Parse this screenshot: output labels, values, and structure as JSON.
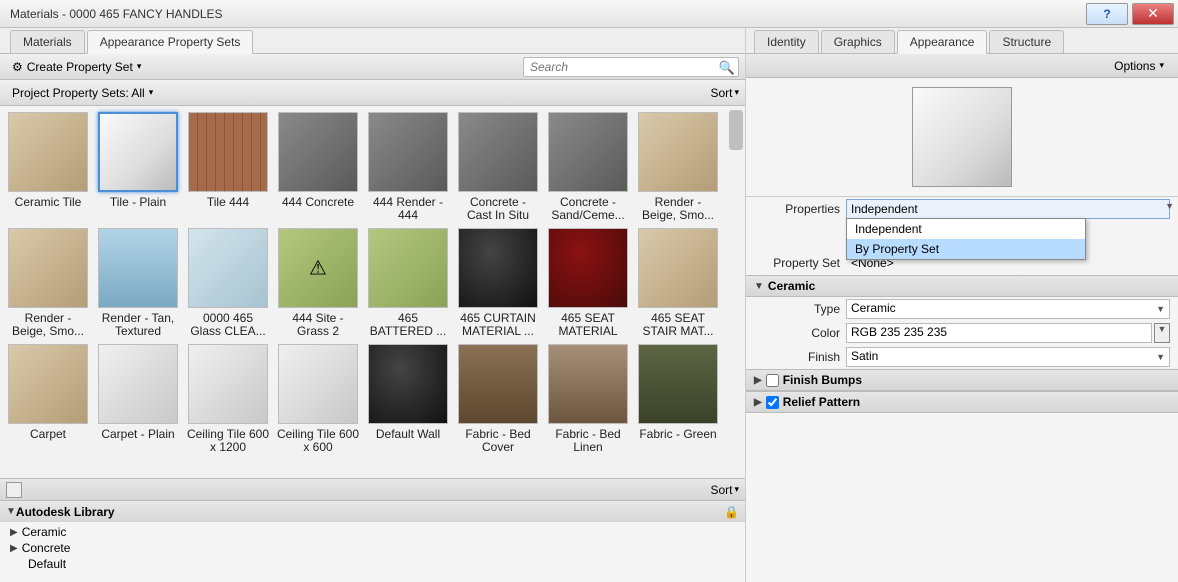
{
  "window": {
    "title": "Materials - 0000 465 FANCY HANDLES"
  },
  "left_tabs": [
    {
      "label": "Materials",
      "active": false
    },
    {
      "label": "Appearance Property Sets",
      "active": true
    }
  ],
  "toolbar": {
    "create_label": "Create Property Set",
    "search_placeholder": "Search"
  },
  "filter_bar": {
    "project_label": "Project Property Sets: All",
    "sort_label": "Sort"
  },
  "grid": {
    "items": [
      {
        "label": "Ceramic Tile",
        "cls": "t-tan"
      },
      {
        "label": "Tile - Plain",
        "cls": "t-cube light",
        "selected": true
      },
      {
        "label": "Tile 444",
        "cls": "t-tile"
      },
      {
        "label": "444 Concrete",
        "cls": "t-gray"
      },
      {
        "label": "444 Render - 444",
        "cls": "t-gray"
      },
      {
        "label": "Concrete - Cast In Situ",
        "cls": "t-gray"
      },
      {
        "label": "Concrete - Sand/Ceme...",
        "cls": "t-gray"
      },
      {
        "label": "Render - Beige, Smo...",
        "cls": "t-tan"
      },
      {
        "label": "Render - Beige, Smo...",
        "cls": "t-tan"
      },
      {
        "label": "Render - Tan, Textured",
        "cls": "t-sky"
      },
      {
        "label": "0000 465 Glass CLEA...",
        "cls": "t-glass"
      },
      {
        "label": "444 Site - Grass 2",
        "cls": "t-green",
        "warn": true
      },
      {
        "label": "465 BATTERED ...",
        "cls": "t-green"
      },
      {
        "label": "465 CURTAIN MATERIAL ...",
        "cls": "t-dark"
      },
      {
        "label": "465 SEAT MATERIAL",
        "cls": "t-red"
      },
      {
        "label": "465 SEAT STAIR MAT...",
        "cls": "t-tan"
      },
      {
        "label": "Carpet",
        "cls": "t-tan"
      },
      {
        "label": "Carpet - Plain",
        "cls": "t-wht"
      },
      {
        "label": "Ceiling Tile 600 x 1200",
        "cls": "t-wht"
      },
      {
        "label": "Ceiling Tile 600 x 600",
        "cls": "t-wht"
      },
      {
        "label": "Default Wall",
        "cls": "t-dark"
      },
      {
        "label": "Fabric - Bed Cover",
        "cls": "t-fab1"
      },
      {
        "label": "Fabric - Bed Linen",
        "cls": "t-fab2"
      },
      {
        "label": "Fabric - Green",
        "cls": "t-fab3"
      }
    ]
  },
  "bottom": {
    "sort_label": "Sort"
  },
  "library": {
    "header": "Autodesk Library",
    "items": [
      "Ceramic",
      "Concrete",
      "Default"
    ]
  },
  "right_tabs": [
    {
      "label": "Identity",
      "active": false
    },
    {
      "label": "Graphics",
      "active": false
    },
    {
      "label": "Appearance",
      "active": true
    },
    {
      "label": "Structure",
      "active": false
    }
  ],
  "options_label": "Options",
  "properties": {
    "properties_label": "Properties",
    "properties_value": "Independent",
    "dropdown_options": [
      "Independent",
      "By Property Set"
    ],
    "dropdown_highlight": 1,
    "propset_label": "Property Set",
    "propset_value": "<None>"
  },
  "ceramic": {
    "heading": "Ceramic",
    "type_label": "Type",
    "type_value": "Ceramic",
    "color_label": "Color",
    "color_value": "RGB 235 235 235",
    "finish_label": "Finish",
    "finish_value": "Satin"
  },
  "sections": {
    "bumps_label": "Finish Bumps",
    "bumps_checked": false,
    "relief_label": "Relief Pattern",
    "relief_checked": true
  }
}
